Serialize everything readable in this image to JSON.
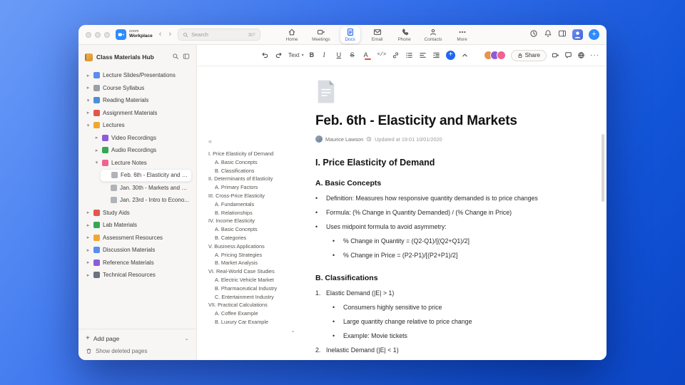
{
  "titlebar": {
    "brand_top": "zoom",
    "brand_bottom": "Workplace",
    "search_placeholder": "Search",
    "search_shortcut": "⌘F",
    "tabs": [
      {
        "label": "Home"
      },
      {
        "label": "Meetings"
      },
      {
        "label": "Docs"
      },
      {
        "label": "Email"
      },
      {
        "label": "Phone"
      },
      {
        "label": "Contacts"
      },
      {
        "label": "More"
      }
    ]
  },
  "sidebar": {
    "title": "Class Materials Hub",
    "items": [
      {
        "label": "Lecture Slides/Presentations",
        "level": 0,
        "chevron": "right",
        "icon": "presentation-icon",
        "color": "#5b8def"
      },
      {
        "label": "Course Syllabus",
        "level": 0,
        "chevron": "right",
        "icon": "clipboard-icon",
        "color": "#9aa0a6"
      },
      {
        "label": "Reading Materials",
        "level": 0,
        "chevron": "down",
        "icon": "book-icon",
        "color": "#4a90d9"
      },
      {
        "label": "Assignment Materials",
        "level": 0,
        "chevron": "right",
        "icon": "magnet-icon",
        "color": "#e2574c"
      },
      {
        "label": "Lectures",
        "level": 0,
        "chevron": "down",
        "icon": "tag-icon",
        "color": "#f0a732"
      },
      {
        "label": "Video Recordings",
        "level": 1,
        "chevron": "right",
        "icon": "video-icon",
        "color": "#8e5bd9"
      },
      {
        "label": "Audio Recordings",
        "level": 1,
        "chevron": "right",
        "icon": "audio-icon",
        "color": "#34a853"
      },
      {
        "label": "Lecture Notes",
        "level": 1,
        "chevron": "down",
        "icon": "notes-icon",
        "color": "#f06292"
      },
      {
        "label": "Feb. 6th - Elasticity and M...",
        "level": 2,
        "chevron": "none",
        "icon": "page-icon",
        "color": "#b0b4b9",
        "selected": true
      },
      {
        "label": "Jan. 30th - Markets and P...",
        "level": 2,
        "chevron": "none",
        "icon": "page-icon",
        "color": "#b0b4b9"
      },
      {
        "label": "Jan. 23rd - Intro to Econo...",
        "level": 2,
        "chevron": "none",
        "icon": "page-icon",
        "color": "#b0b4b9"
      },
      {
        "label": "Study Aids",
        "level": 0,
        "chevron": "right",
        "icon": "apple-icon",
        "color": "#e2574c"
      },
      {
        "label": "Lab Materials",
        "level": 0,
        "chevron": "right",
        "icon": "flask-icon",
        "color": "#34a853"
      },
      {
        "label": "Assessment Resources",
        "level": 0,
        "chevron": "right",
        "icon": "ruler-icon",
        "color": "#f0a732"
      },
      {
        "label": "Discussion Materials",
        "level": 0,
        "chevron": "right",
        "icon": "chat-icon",
        "color": "#5b8def"
      },
      {
        "label": "Reference Materials",
        "level": 0,
        "chevron": "right",
        "icon": "books-icon",
        "color": "#8e5bd9"
      },
      {
        "label": "Technical Resources",
        "level": 0,
        "chevron": "right",
        "icon": "wrench-icon",
        "color": "#6b7280"
      }
    ],
    "add_page_label": "Add page",
    "show_deleted_label": "Show deleted pages"
  },
  "toolbar": {
    "text_style_label": "Text",
    "share_label": "Share"
  },
  "doc": {
    "title": "Feb. 6th - Elasticity and Markets",
    "author": "Maurice Lawson",
    "updated": "Updated at 19:01 10/01/2020",
    "toc": [
      {
        "label": "I. Price Elasticity of Demand",
        "level": 0
      },
      {
        "label": "A. Basic Concepts",
        "level": 1
      },
      {
        "label": "B. Classifications",
        "level": 1
      },
      {
        "label": "II. Determinants of Elasticity",
        "level": 0
      },
      {
        "label": "A. Primary Factors",
        "level": 1
      },
      {
        "label": "III. Cross-Price Elasticity",
        "level": 0
      },
      {
        "label": "A. Fundamentals",
        "level": 1
      },
      {
        "label": "B. Relationships",
        "level": 1
      },
      {
        "label": "IV. Income Elasticity",
        "level": 0
      },
      {
        "label": "A. Basic Concepts",
        "level": 1
      },
      {
        "label": "B. Categories",
        "level": 1
      },
      {
        "label": "V. Business Applications",
        "level": 0
      },
      {
        "label": "A. Pricing Strategies",
        "level": 1
      },
      {
        "label": "B. Market Analysis",
        "level": 1
      },
      {
        "label": "VI. Real-World Case Studies",
        "level": 0
      },
      {
        "label": "A. Electric Vehicle Market",
        "level": 1
      },
      {
        "label": "B. Pharmaceutical Industry",
        "level": 1
      },
      {
        "label": "C. Entertainment Industry",
        "level": 1
      },
      {
        "label": "VII. Practical Calculations",
        "level": 0
      },
      {
        "label": "A. Coffee Example",
        "level": 1
      },
      {
        "label": "B. Luxury Car Example",
        "level": 1
      }
    ],
    "section1_heading": "I. Price Elasticity of Demand",
    "section1a_heading": "A. Basic Concepts",
    "basic_concepts_items": [
      {
        "marker": "•",
        "text": "Definition: Measures how responsive quantity demanded is to price changes",
        "level": 0
      },
      {
        "marker": "•",
        "text": "Formula: (% Change in Quantity Demanded) / (% Change in Price)",
        "level": 0
      },
      {
        "marker": "•",
        "text": "Uses midpoint formula to avoid asymmetry:",
        "level": 0
      },
      {
        "marker": "•",
        "text": "% Change in Quantity = (Q2-Q1)/[(Q2+Q1)/2]",
        "level": 1
      },
      {
        "marker": "•",
        "text": "% Change in Price = (P2-P1)/[(P2+P1)/2]",
        "level": 1
      }
    ],
    "section1b_heading": "B. Classifications",
    "classification_items": [
      {
        "marker": "1.",
        "text": "Elastic Demand (|E| > 1)",
        "level": 0
      },
      {
        "marker": "•",
        "text": "Consumers highly sensitive to price",
        "level": 1
      },
      {
        "marker": "•",
        "text": "Large quantity change relative to price change",
        "level": 1
      },
      {
        "marker": "•",
        "text": "Example: Movie tickets",
        "level": 1
      },
      {
        "marker": "2.",
        "text": "Inelastic Demand (|E| < 1)",
        "level": 0
      }
    ]
  }
}
